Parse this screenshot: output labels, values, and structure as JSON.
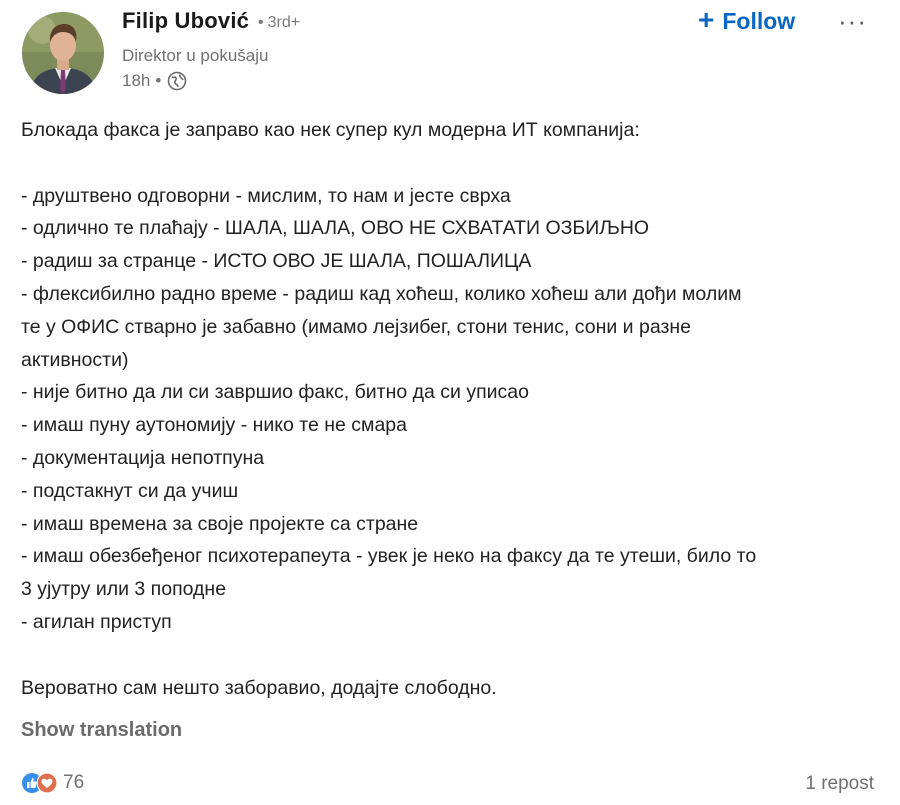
{
  "author": {
    "name": "Filip Ubović",
    "degree": "3rd+",
    "headline": "Direktor u pokušaju",
    "time": "18h",
    "visibility_icon": "globe-icon"
  },
  "actions": {
    "follow_label": "Follow",
    "follow_icon": "plus-icon",
    "more_label": "···"
  },
  "post": {
    "lines": [
      "Блокада факса је заправо као нек супер кул модерна ИТ компанија:",
      "",
      "- друштвено одговорни - мислим, то нам и јесте сврха",
      "- одлично те плаћају - ШАЛА, ШАЛА, ОВО НЕ СХВАТАТИ ОЗБИЉНО",
      "- радиш за странце - ИСТО ОВО ЈЕ ШАЛА, ПОШАЛИЦА",
      "- флексибилно радно време - радиш кад хоћеш, колико хоћеш али дођи молим",
      "те у ОФИС стварно је забавно (имамо лејзибег, стони тенис, сони и разне",
      "активности)",
      "- није битно да ли си завршио факс, битно да си уписао",
      "- имаш пуну аутономију - нико те не смара",
      "- документација непотпуна",
      "- подстакнут си да учиш",
      "- имаш времена за своје пројекте са стране",
      "- имаш обезбеђеног психотерапеута - увек је неко на факсу да те утеши, било то",
      "3 ујутру или 3 поподне",
      "- агилан приступ",
      "",
      "Вероватно сам нешто заборавио, додајте слободно."
    ],
    "show_translation": "Show translation"
  },
  "social": {
    "reaction_icons": [
      "like-icon",
      "love-icon"
    ],
    "reaction_count": "76",
    "reposts": "1 repost"
  },
  "colors": {
    "accent": "#0a66c2",
    "like": "#378fe9",
    "love": "#df704d",
    "muted_text": "#707070"
  }
}
